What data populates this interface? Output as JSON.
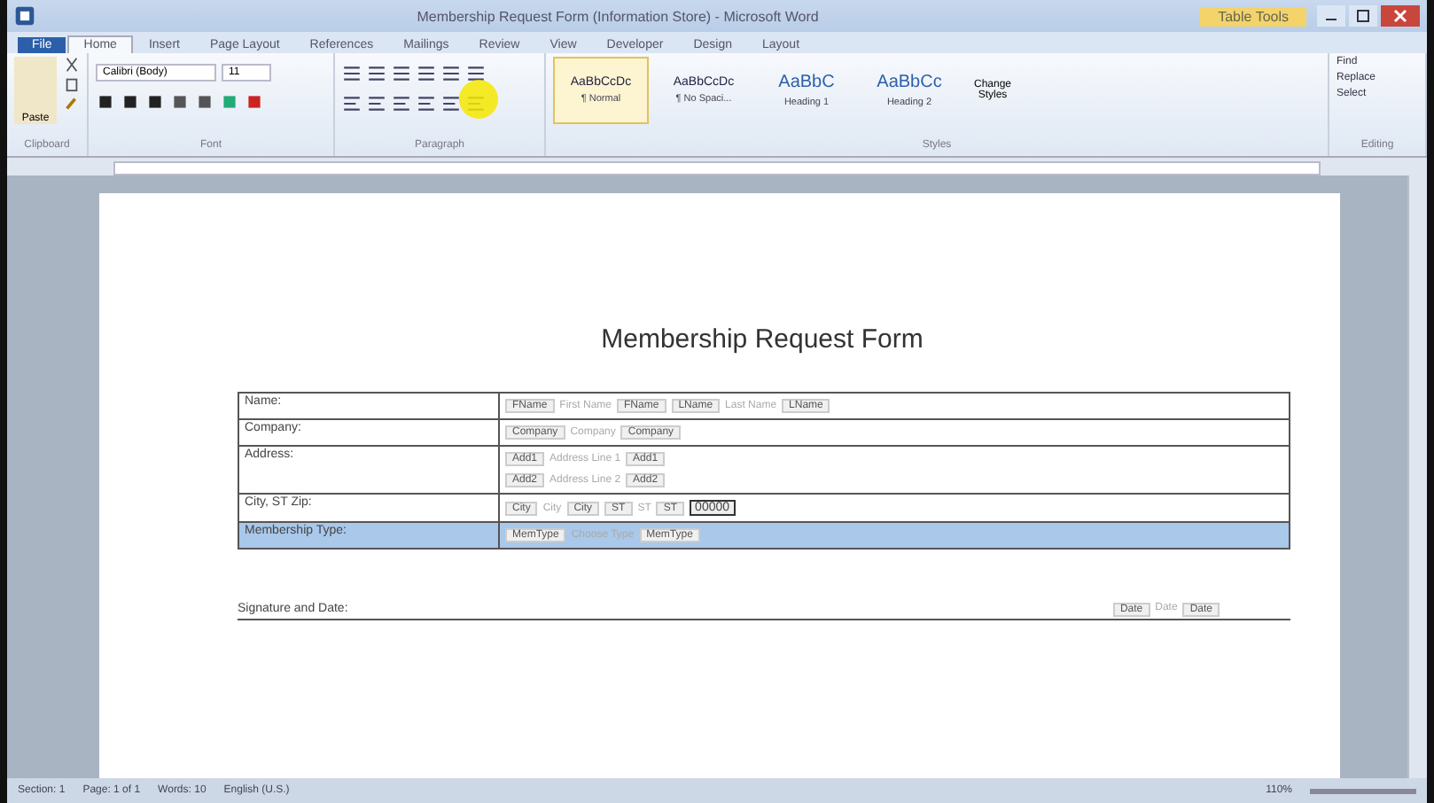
{
  "window": {
    "title": "Membership Request Form (Information Store) - Microsoft Word",
    "context_tab": "Table Tools"
  },
  "tabs": [
    {
      "label": "File",
      "kind": "file",
      "selected": false
    },
    {
      "label": "Home",
      "kind": "tab",
      "selected": true
    },
    {
      "label": "Insert",
      "kind": "tab",
      "selected": false
    },
    {
      "label": "Page Layout",
      "kind": "tab",
      "selected": false
    },
    {
      "label": "References",
      "kind": "tab",
      "selected": false
    },
    {
      "label": "Mailings",
      "kind": "tab",
      "selected": false
    },
    {
      "label": "Review",
      "kind": "tab",
      "selected": false
    },
    {
      "label": "View",
      "kind": "tab",
      "selected": false
    },
    {
      "label": "Developer",
      "kind": "tab",
      "selected": false
    },
    {
      "label": "Design",
      "kind": "tab",
      "selected": false
    },
    {
      "label": "Layout",
      "kind": "tab",
      "selected": false
    }
  ],
  "ribbon": {
    "paste": "Paste",
    "font_name": "Calibri (Body)",
    "font_size": "11",
    "groups": [
      "Clipboard",
      "Font",
      "Paragraph",
      "Styles",
      "Editing"
    ],
    "styles": [
      {
        "sample": "AaBbCcDc",
        "name": "¶ Normal",
        "selected": true
      },
      {
        "sample": "AaBbCcDc",
        "name": "¶ No Spaci...",
        "selected": false
      },
      {
        "sample": "AaBbC",
        "name": "Heading 1",
        "selected": false
      },
      {
        "sample": "AaBbCc",
        "name": "Heading 2",
        "selected": false
      }
    ],
    "change_styles": "Change Styles",
    "editing": [
      "Find",
      "Replace",
      "Select"
    ]
  },
  "document": {
    "title": "Membership Request Form",
    "rows": [
      {
        "label": "Name:",
        "selected": false,
        "lines": [
          [
            {
              "kind": "tag",
              "text": "FName"
            },
            {
              "kind": "placeholder",
              "text": "First Name"
            },
            {
              "kind": "tag",
              "text": "FName"
            },
            {
              "kind": "tag",
              "text": "LName"
            },
            {
              "kind": "placeholder",
              "text": "Last Name"
            },
            {
              "kind": "tag",
              "text": "LName"
            }
          ]
        ]
      },
      {
        "label": "Company:",
        "selected": false,
        "lines": [
          [
            {
              "kind": "tag",
              "text": "Company"
            },
            {
              "kind": "placeholder",
              "text": "Company"
            },
            {
              "kind": "tag",
              "text": "Company"
            }
          ]
        ]
      },
      {
        "label": "Address:",
        "selected": false,
        "lines": [
          [
            {
              "kind": "tag",
              "text": "Add1"
            },
            {
              "kind": "placeholder",
              "text": "Address Line 1"
            },
            {
              "kind": "tag",
              "text": "Add1"
            }
          ],
          [
            {
              "kind": "tag",
              "text": "Add2"
            },
            {
              "kind": "placeholder",
              "text": "Address Line 2"
            },
            {
              "kind": "tag",
              "text": "Add2"
            }
          ]
        ]
      },
      {
        "label": "City, ST Zip:",
        "selected": false,
        "lines": [
          [
            {
              "kind": "tag",
              "text": "City"
            },
            {
              "kind": "placeholder",
              "text": "City"
            },
            {
              "kind": "tag",
              "text": "City"
            },
            {
              "kind": "tag",
              "text": "ST"
            },
            {
              "kind": "placeholder",
              "text": "ST"
            },
            {
              "kind": "tag",
              "text": "ST"
            },
            {
              "kind": "value",
              "text": "00000"
            }
          ]
        ]
      },
      {
        "label": "Membership Type:",
        "selected": true,
        "lines": [
          [
            {
              "kind": "tag",
              "text": "MemType"
            },
            {
              "kind": "placeholder",
              "text": "Choose Type"
            },
            {
              "kind": "tag",
              "text": "MemType"
            }
          ]
        ]
      }
    ],
    "signature": {
      "label": "Signature and Date:",
      "parts": [
        {
          "kind": "tag",
          "text": "Date"
        },
        {
          "kind": "placeholder",
          "text": "Date"
        },
        {
          "kind": "tag",
          "text": "Date"
        }
      ]
    }
  },
  "status_bar": {
    "items": [
      "Section: 1",
      "Page: 1 of 1",
      "Words: 10",
      "English (U.S.)"
    ],
    "zoom": "110%"
  }
}
